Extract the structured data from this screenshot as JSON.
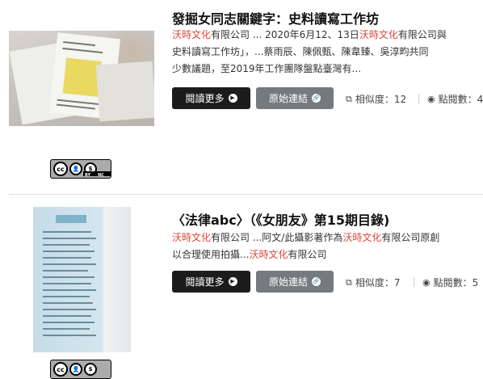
{
  "results": [
    {
      "title": "發掘女同志關鍵字：史料讀寫工作坊",
      "snippet_lines": [
        [
          {
            "t": "沃時文化",
            "hl": true
          },
          {
            "t": "有限公司 ... 2020年6月12、13日",
            "hl": false
          },
          {
            "t": "沃時文化",
            "hl": true
          },
          {
            "t": "有限公司與",
            "hl": false
          }
        ],
        [
          {
            "t": "史料讀寫工作坊」，...蔡雨辰、陳佩甄、陳韋臻、吳淳畇共同",
            "hl": false
          }
        ],
        [
          {
            "t": "少數議題，至2019年工作團隊盤點臺灣有...",
            "hl": false
          }
        ]
      ],
      "read_more": "閱讀更多",
      "original_link": "原始連結",
      "similarity_label": "相似度：12",
      "views_label": "點閱數：4"
    },
    {
      "title": "〈法律abc〉（《女朋友》第15期目錄)",
      "snippet_lines": [
        [
          {
            "t": "沃時文化",
            "hl": true
          },
          {
            "t": "有限公司 ...阿文/此攝影著作為",
            "hl": false
          },
          {
            "t": "沃時文化",
            "hl": true
          },
          {
            "t": "有限公司原創",
            "hl": false
          }
        ],
        [
          {
            "t": "以合理使用拍攝...",
            "hl": false
          },
          {
            "t": "沃時文化",
            "hl": true
          },
          {
            "t": "有限公司",
            "hl": false
          }
        ]
      ],
      "read_more": "閱讀更多",
      "original_link": "原始連結",
      "similarity_label": "相似度：7",
      "views_label": "點閱數：5"
    }
  ],
  "license": {
    "cc": "cc",
    "by": "BY",
    "nc": "NC"
  },
  "icons": {
    "read_more": "chevron-right-circle-icon",
    "original_link": "link-circle-icon",
    "similarity": "copy-icon",
    "views": "eye-icon"
  },
  "colors": {
    "highlight": "#e0453c",
    "read_more_bg": "#1c1c1c",
    "original_bg": "#747a7e"
  }
}
